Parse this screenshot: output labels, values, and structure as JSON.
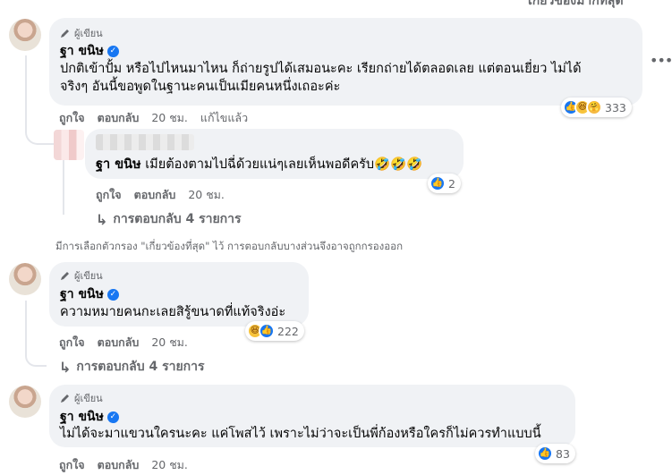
{
  "header": {
    "filter_label": "เกี่ยวข้องมากที่สุด",
    "more_icon": "more-horizontal-icon"
  },
  "comments": [
    {
      "badge": "ผู้เขียน",
      "author": "ฐา ขนิษ",
      "verified": true,
      "text_line1": "ปกติเข้าปั้ม หรือไปไหนมาไหน ก็ถ่ายรูปได้เสมอนะคะ เรียกถ่ายได้ตลอดเลย แต่ตอนเยี่ยว ไม่ได้",
      "text_line2": "จริงๆ อันนี้ขอพูดในฐานะคนเป็นเมียคนหนึ่งเถอะค่ะ",
      "actions": {
        "like": "ถูกใจ",
        "reply": "ตอบกลับ",
        "time": "20 ชม.",
        "edited": "แก้ไขแล้ว"
      },
      "reactions": {
        "icons": [
          "like",
          "haha",
          "care"
        ],
        "count": "333"
      }
    },
    {
      "author_prefix": "ฐา ขนิษ",
      "text": "เมียต้องตามไปฉี่ด้วยแน่ๆเลยเห็นพอดีครับ🤣🤣🤣",
      "actions": {
        "like": "ถูกใจ",
        "reply": "ตอบกลับ",
        "time": "20 ชม."
      },
      "reactions": {
        "icons": [
          "like"
        ],
        "count": "2"
      }
    },
    {
      "badge": "ผู้เขียน",
      "author": "ฐา ขนิษ",
      "verified": true,
      "text": "ความหมายคนกะเลยสิรู้ขนาดที่แท้จริงอ่ะ",
      "actions": {
        "like": "ถูกใจ",
        "reply": "ตอบกลับ",
        "time": "20 ชม."
      },
      "reactions": {
        "icons": [
          "haha",
          "like"
        ],
        "count": "222"
      }
    },
    {
      "badge": "ผู้เขียน",
      "author": "ฐา ขนิษ",
      "verified": true,
      "text": "ไม่ได้จะมาแขวนใครนะคะ แค่โพสไว้ เพราะไม่ว่าจะเป็นพี่ก้องหรือใครก็ไม่ควรทำแบบนี้",
      "actions": {
        "like": "ถูกใจ",
        "reply": "ตอบกลับ",
        "time": "20 ชม."
      },
      "reactions": {
        "icons": [
          "like"
        ],
        "count": "83"
      }
    }
  ],
  "view_replies_1": "การตอบกลับ 4 รายการ",
  "view_replies_2": "การตอบกลับ 4 รายการ",
  "filter_notice": "มีการเลือกตัวกรอง \"เกี่ยวข้องที่สุด\" ไว้ การตอบกลับบางส่วนจึงอาจถูกกรองออก",
  "colors": {
    "bubble": "#f0f2f5",
    "meta": "#65676b",
    "like_blue": "#1877f2"
  }
}
